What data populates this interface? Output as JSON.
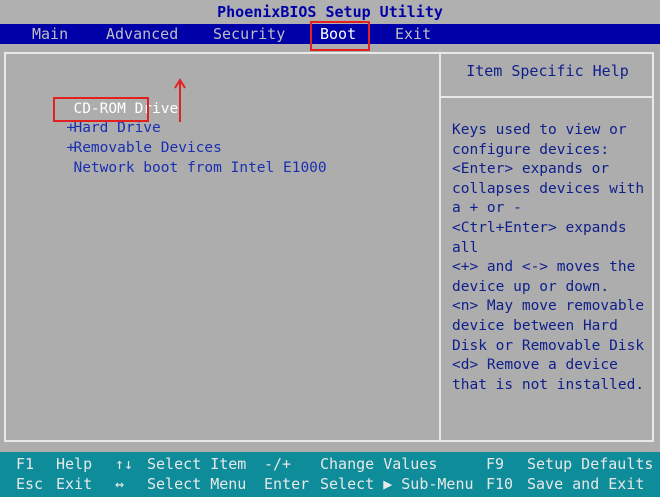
{
  "title": "PhoenixBIOS Setup Utility",
  "menu": [
    {
      "label": "Main"
    },
    {
      "label": "Advanced"
    },
    {
      "label": "Security"
    },
    {
      "label": "Boot"
    },
    {
      "label": "Exit"
    }
  ],
  "active_menu": "Boot",
  "boot_list": [
    {
      "prefix": "",
      "label": "CD-ROM Drive"
    },
    {
      "prefix": "+",
      "label": "Hard Drive"
    },
    {
      "prefix": "+",
      "label": "Removable Devices"
    },
    {
      "prefix": "",
      "label": "Network boot from Intel E1000"
    }
  ],
  "help": {
    "title": "Item Specific Help",
    "text": "Keys used to view or\nconfigure devices:\n<Enter> expands or\ncollapses devices with\na + or -\n<Ctrl+Enter> expands\nall\n<+> and <-> moves the\ndevice up or down.\n<n> May move removable\ndevice between Hard\nDisk or Removable Disk\n<d> Remove a device\nthat is not installed."
  },
  "keys": {
    "f1": "F1",
    "help": "Help",
    "updown": "↑↓",
    "select_item": "Select Item",
    "minus_plus": "-/+",
    "change_values": "Change Values",
    "f9": "F9",
    "setup_defaults": "Setup Defaults",
    "esc": "Esc",
    "exit": "Exit",
    "leftright": "↔",
    "select_menu": "Select Menu",
    "enter": "Enter",
    "select_submenu": "Select ▶ Sub-Menu",
    "f10": "F10",
    "save_exit": "Save and Exit"
  },
  "colors": {
    "menubar": "#0000a8",
    "background": "#adadad",
    "statusbar": "#0e8c9a",
    "annotation": "#e32020"
  }
}
